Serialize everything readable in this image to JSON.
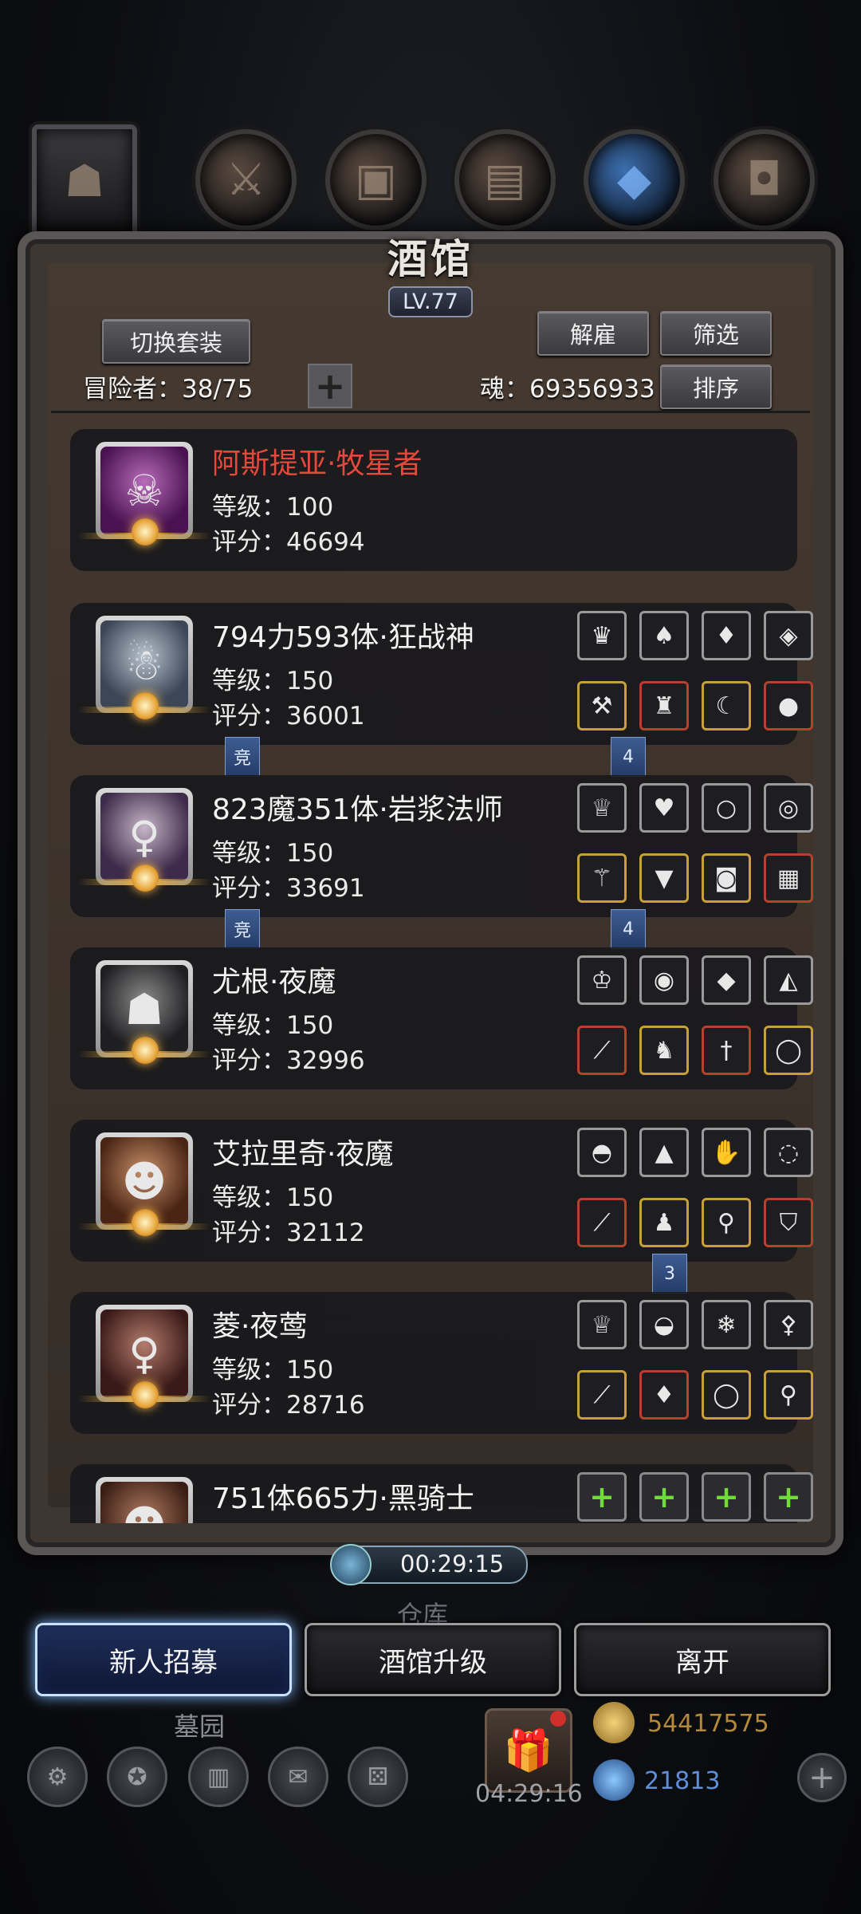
{
  "top_tabs": [
    {
      "name": "hero-portrait"
    },
    {
      "name": "weapon"
    },
    {
      "name": "armor"
    },
    {
      "name": "boots"
    },
    {
      "name": "crystal"
    },
    {
      "name": "helmet"
    }
  ],
  "tavern": {
    "title": "酒馆",
    "level": "LV.77",
    "switch_set_label": "切换套装",
    "dismiss_label": "解雇",
    "filter_label": "筛选",
    "sort_label": "排序",
    "adventurers_label": "冒险者：38/75",
    "soul_label": "魂：69356933"
  },
  "heroes": [
    {
      "name": "阿斯提亚·牧星者",
      "level": "等级：100",
      "score": "评分：46694",
      "portrait": "hooded-figure",
      "name_color": "#e14a3c"
    },
    {
      "name": "794力593体·狂战神",
      "level": "等级：150",
      "score": "评分：36001",
      "portrait": "bearded-warrior"
    },
    {
      "name": "823魔351体·岩浆法师",
      "level": "等级：150",
      "score": "评分：33691",
      "portrait": "witch"
    },
    {
      "name": "尤根·夜魔",
      "level": "等级：150",
      "score": "评分：32996",
      "portrait": "masked-knight"
    },
    {
      "name": "艾拉里奇·夜魔",
      "level": "等级：150",
      "score": "评分：32112",
      "portrait": "eyepatch-man"
    },
    {
      "name": "菱·夜莺",
      "level": "等级：150",
      "score": "评分：28716",
      "portrait": "hat-lady"
    },
    {
      "name": "751体665力·黑骑士",
      "level": "",
      "score": "",
      "portrait": "long-hair-man"
    }
  ],
  "tags": {
    "compete": "竞",
    "row2_count": "4",
    "row3_count": "4",
    "row5_count": "3"
  },
  "timer": {
    "value": "00:29:15"
  },
  "bottom_buttons": {
    "recruit": "新人招募",
    "upgrade": "酒馆升级",
    "leave": "离开"
  },
  "background": {
    "warehouse": "仓库",
    "cemetery": "墓园",
    "gift_timer": "04:29:16",
    "gold": "54417575",
    "gems": "21813"
  },
  "colors": {
    "accent_gold": "#e0a93d",
    "tag_blue": "#3e5d92",
    "hero_name_red": "#e14a3c"
  }
}
